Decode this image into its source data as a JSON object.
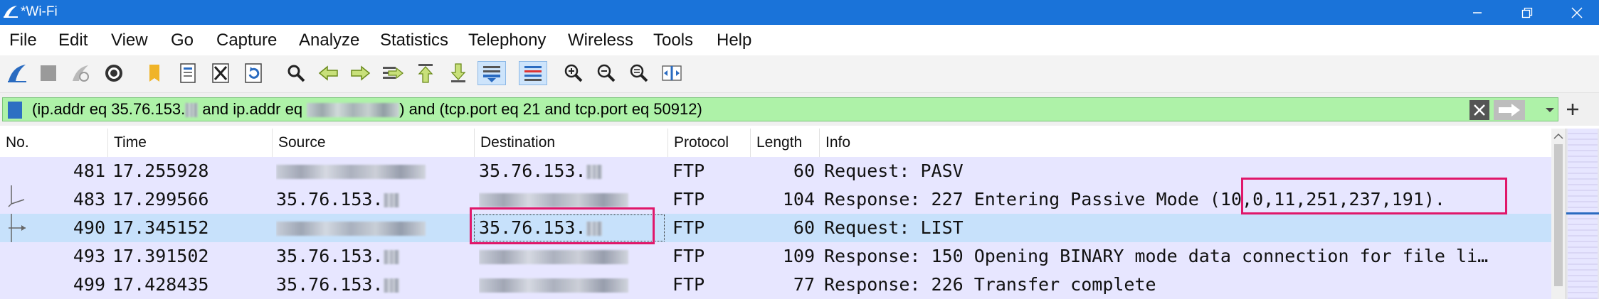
{
  "window": {
    "title": "*Wi-Fi",
    "buttons": [
      "minimize",
      "restore",
      "close"
    ]
  },
  "menu": [
    "File",
    "Edit",
    "View",
    "Go",
    "Capture",
    "Analyze",
    "Statistics",
    "Telephony",
    "Wireless",
    "Tools",
    "Help"
  ],
  "toolbar_icons": [
    "start-capture-icon",
    "stop-capture-icon",
    "restart-capture-icon",
    "capture-options-icon",
    "open-file-icon",
    "save-file-icon",
    "close-file-icon",
    "reload-file-icon",
    "find-packet-icon",
    "go-back-icon",
    "go-forward-icon",
    "go-to-packet-icon",
    "go-first-icon",
    "go-last-icon",
    "auto-scroll-icon",
    "colorize-icon",
    "zoom-in-icon",
    "zoom-out-icon",
    "zoom-normal-icon",
    "resize-columns-icon"
  ],
  "filter": {
    "part1": "(ip.addr eq 35.76.153.",
    "part2": " and ip.addr eq ",
    "part3": ") and (tcp.port eq 21 and tcp.port eq 50912)",
    "background": "#aef2a8"
  },
  "columns": [
    "No.",
    "Time",
    "Source",
    "Destination",
    "Protocol",
    "Length",
    "Info"
  ],
  "packets": [
    {
      "no": "481",
      "time": "17.255928",
      "src_prefix": "",
      "dst_prefix": "35.76.153.",
      "protocol": "FTP",
      "length": "60",
      "info": "Request: PASV",
      "selected": false
    },
    {
      "no": "483",
      "time": "17.299566",
      "src_prefix": "35.76.153.",
      "dst_prefix": "",
      "protocol": "FTP",
      "length": "104",
      "info": "Response: 227 Entering Passive Mode ",
      "info_highlight": "(10,0,11,251,237,191).",
      "selected": false
    },
    {
      "no": "490",
      "time": "17.345152",
      "src_prefix": "",
      "dst_prefix": "35.76.153.",
      "protocol": "FTP",
      "length": "60",
      "info": "Request: LIST",
      "selected": true
    },
    {
      "no": "493",
      "time": "17.391502",
      "src_prefix": "35.76.153.",
      "dst_prefix": "",
      "protocol": "FTP",
      "length": "109",
      "info": "Response: 150 Opening BINARY mode data connection for file li…",
      "selected": false
    },
    {
      "no": "499",
      "time": "17.428435",
      "src_prefix": "35.76.153.",
      "dst_prefix": "",
      "protocol": "FTP",
      "length": "77",
      "info": "Response: 226 Transfer complete",
      "selected": false
    }
  ],
  "colors": {
    "titlebar": "#1a73d9",
    "row_bg": "#e7e6ff",
    "row_selected": "#c7e1fb",
    "annotation": "#e0176a"
  }
}
